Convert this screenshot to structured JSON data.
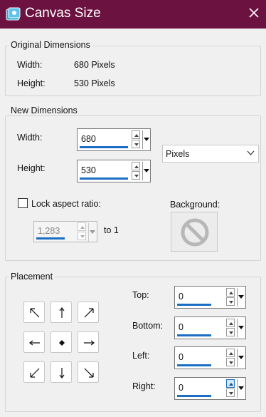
{
  "window": {
    "title": "Canvas Size",
    "icons": {
      "app": "canvas-size-app-icon",
      "close": "close-icon"
    }
  },
  "original": {
    "group_label": "Original Dimensions",
    "width_label": "Width:",
    "width_value": "680 Pixels",
    "height_label": "Height:",
    "height_value": "530 Pixels"
  },
  "new_dimensions": {
    "group_label": "New Dimensions",
    "width_label": "Width:",
    "width_value": "680",
    "height_label": "Height:",
    "height_value": "530",
    "units_selected": "Pixels",
    "lock_aspect_label": "Lock aspect ratio:",
    "lock_aspect_checked": false,
    "ratio_value": "1,283",
    "ratio_suffix": "to 1",
    "background_label": "Background:",
    "background_icon": "no-symbol-icon"
  },
  "placement": {
    "group_label": "Placement",
    "anchors": [
      "arrow-up-left-icon",
      "arrow-up-icon",
      "arrow-up-right-icon",
      "arrow-left-icon",
      "center-dot-icon",
      "arrow-right-icon",
      "arrow-down-left-icon",
      "arrow-down-icon",
      "arrow-down-right-icon"
    ],
    "top_label": "Top:",
    "top_value": "0",
    "bottom_label": "Bottom:",
    "bottom_value": "0",
    "left_label": "Left:",
    "left_value": "0",
    "right_label": "Right:",
    "right_value": "0"
  },
  "colors": {
    "titlebar": "#6b1240",
    "accent": "#1a6fc4"
  }
}
